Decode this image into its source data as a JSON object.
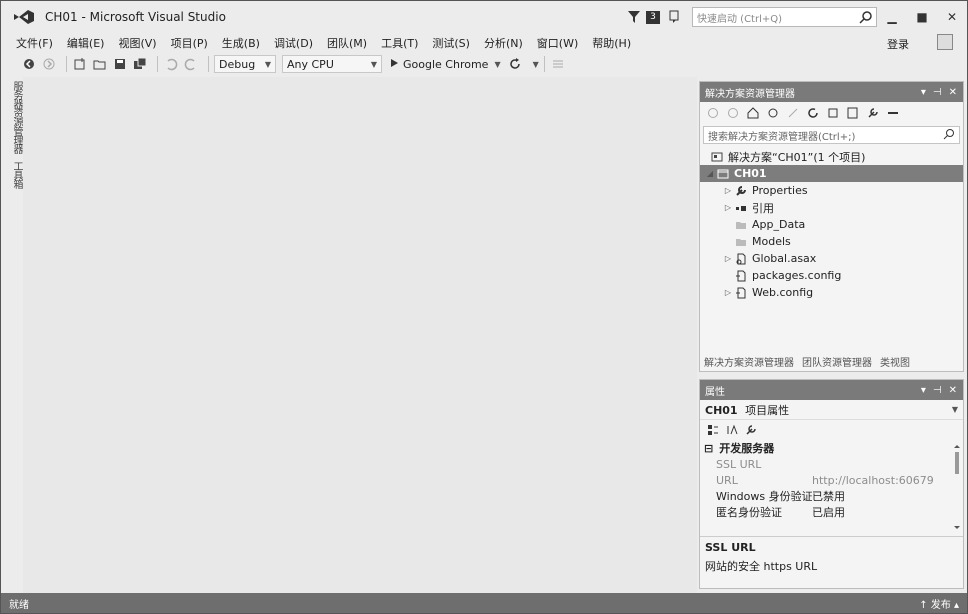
{
  "titlebar": {
    "title": "CH01 - Microsoft Visual Studio",
    "notification_count": "3",
    "quick_launch_placeholder": "快速启动 (Ctrl+Q)"
  },
  "menu": {
    "items": [
      "文件(F)",
      "编辑(E)",
      "视图(V)",
      "项目(P)",
      "生成(B)",
      "调试(D)",
      "团队(M)",
      "工具(T)",
      "测试(S)",
      "分析(N)",
      "窗口(W)",
      "帮助(H)"
    ],
    "login": "登录"
  },
  "toolbar": {
    "config": "Debug",
    "platform": "Any CPU",
    "browser": "Google Chrome"
  },
  "left_tabs": [
    "服务器资源管理器",
    "工具箱"
  ],
  "solution_explorer": {
    "title": "解决方案资源管理器",
    "search_placeholder": "搜索解决方案资源管理器(Ctrl+;)",
    "root": "解决方案“CH01”(1 个项目)",
    "project": "CH01",
    "items": [
      {
        "label": "Properties",
        "expandable": true
      },
      {
        "label": "引用",
        "expandable": true
      },
      {
        "label": "App_Data",
        "expandable": false
      },
      {
        "label": "Models",
        "expandable": false
      },
      {
        "label": "Global.asax",
        "expandable": true
      },
      {
        "label": "packages.config",
        "expandable": false
      },
      {
        "label": "Web.config",
        "expandable": true
      }
    ],
    "bottom_tabs": [
      "解决方案资源管理器",
      "团队资源管理器",
      "类视图"
    ]
  },
  "properties": {
    "title": "属性",
    "object": "CH01",
    "object_type": "项目属性",
    "category": "开发服务器",
    "rows": [
      {
        "name": "SSL URL",
        "value": "",
        "disabled": true
      },
      {
        "name": "URL",
        "value": "http://localhost:60679",
        "disabled": true
      },
      {
        "name": "Windows 身份验证",
        "value": "已禁用",
        "disabled": false
      },
      {
        "name": "匿名身份验证",
        "value": "已启用",
        "disabled": false
      }
    ],
    "desc_title": "SSL URL",
    "desc_text": "网站的安全 https URL"
  },
  "status": {
    "left": "就绪",
    "right": "↑ 发布 ▴"
  },
  "colors": {
    "panel_header": "#7a7a7a",
    "selection": "#7d7d7d",
    "status_bar": "#6e6e6e"
  }
}
